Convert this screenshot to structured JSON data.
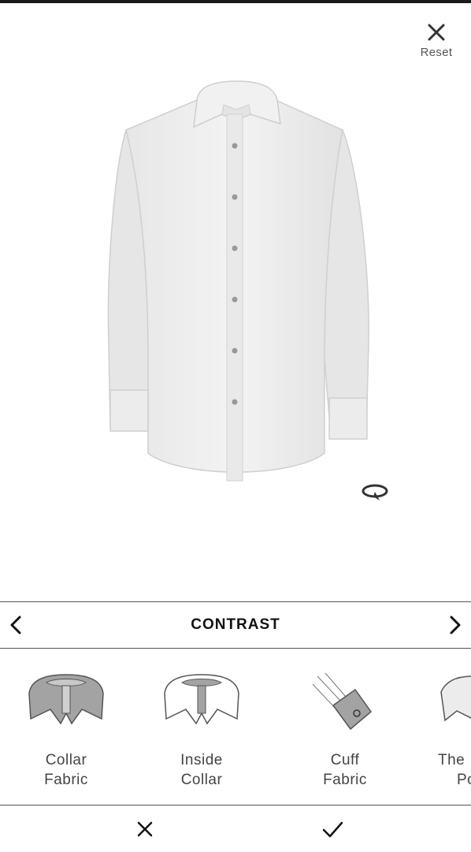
{
  "header": {
    "reset_label": "Reset"
  },
  "nav": {
    "title": "CONTRAST"
  },
  "options": [
    {
      "line1": "Collar",
      "line2": "Fabric"
    },
    {
      "line1": "Inside",
      "line2": "Collar"
    },
    {
      "line1": "Cuff",
      "line2": "Fabric"
    },
    {
      "line1": "The",
      "line2": "Po"
    }
  ],
  "icons": {
    "reset": "close-icon",
    "rotate": "rotate-icon",
    "prev": "chevron-left-icon",
    "next": "chevron-right-icon",
    "cancel": "close-icon",
    "confirm": "checkmark-icon"
  },
  "colors": {
    "shirt": "#ececec",
    "accent_dark": "#1a1a1a",
    "option_fill": "#a3a3a3"
  }
}
